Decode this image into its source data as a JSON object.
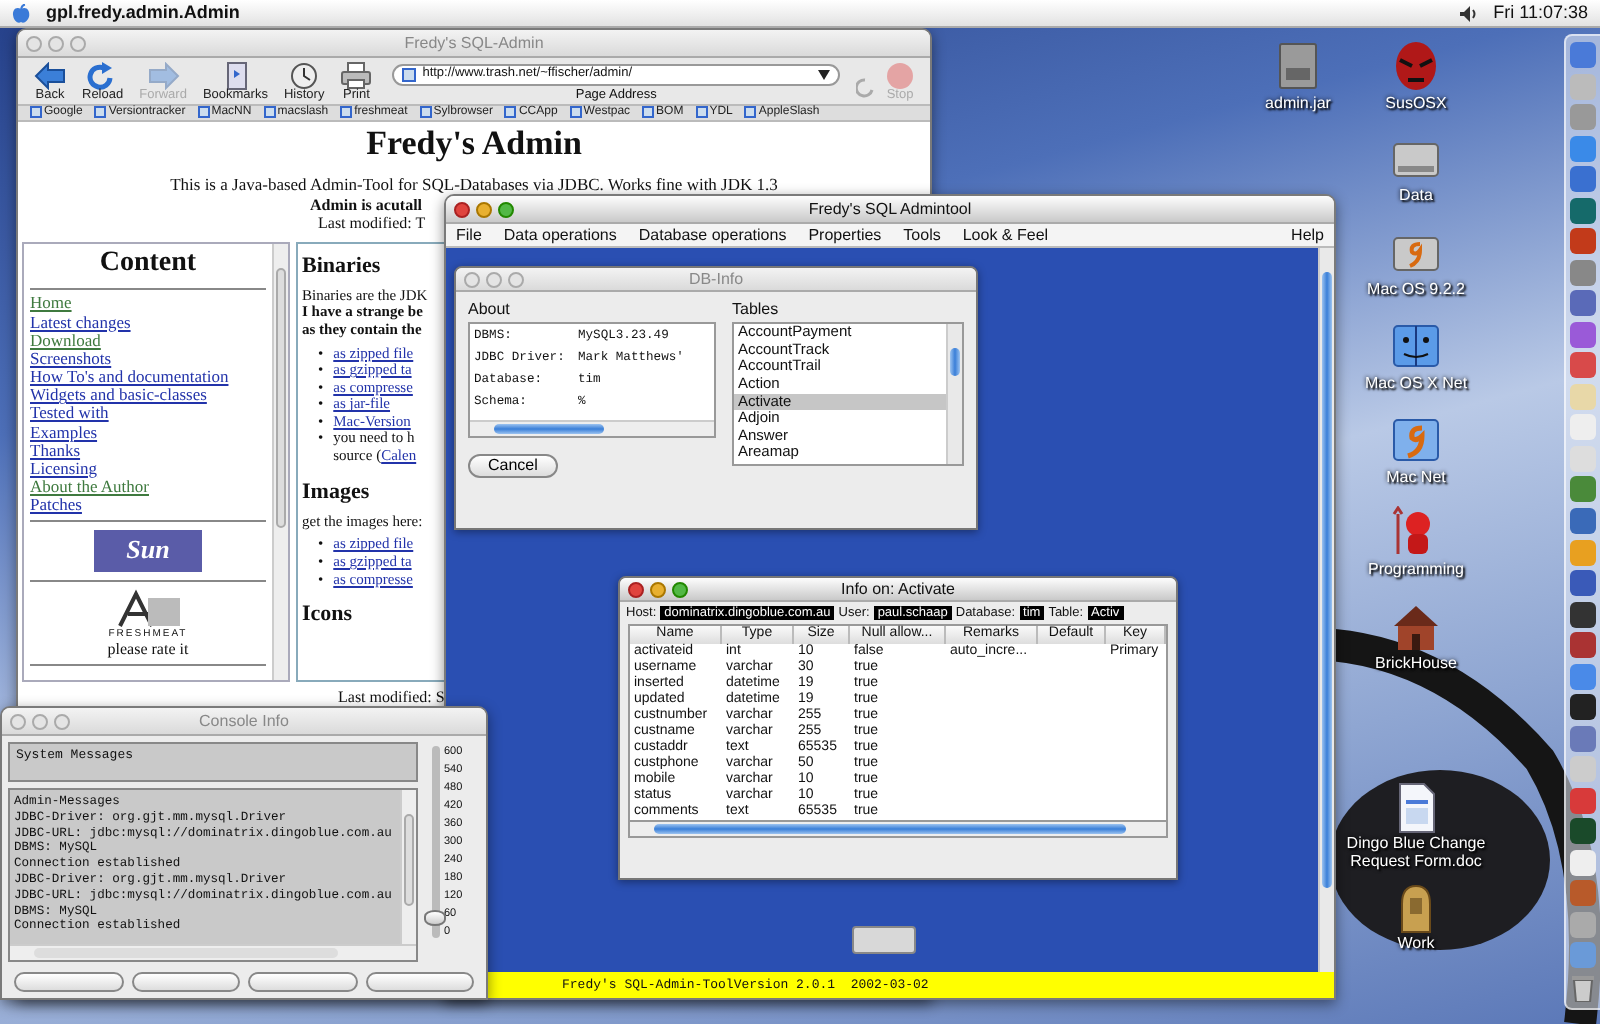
{
  "menu_bar": {
    "app_name": "gpl.fredy.admin.Admin",
    "clock": "Fri 11:07:38"
  },
  "browser": {
    "title": "Fredy's SQL-Admin",
    "active": false,
    "toolbar": [
      {
        "kind": "back",
        "label": "Back",
        "disabled": false
      },
      {
        "kind": "reload",
        "label": "Reload",
        "disabled": false
      },
      {
        "kind": "forward",
        "label": "Forward",
        "disabled": true
      },
      {
        "kind": "bookmarks",
        "label": "Bookmarks",
        "disabled": false
      },
      {
        "kind": "history",
        "label": "History",
        "disabled": false
      },
      {
        "kind": "print",
        "label": "Print",
        "disabled": false
      }
    ],
    "address": "http://www.trash.net/~ffischer/admin/",
    "address_label": "Page Address",
    "stop": {
      "label": "Stop",
      "disabled": true
    },
    "favorites": [
      "Google",
      "Versiontracker",
      "MacNN",
      "macslash",
      "freshmeat",
      "Sylbrowser",
      "CCApp",
      "Westpac",
      "BOM",
      "YDL",
      "AppleSlash"
    ],
    "page": {
      "heading": "Fredy's Admin",
      "intro": "This is a Java-based Admin-Tool for SQL-Databases via JDBC. Works fine with JDK 1.3",
      "notice": "Admin is acutall",
      "modified": "Last modified: T",
      "nav": {
        "title": "Content",
        "links": [
          {
            "label": "Home",
            "visited": true
          },
          {
            "label": "Latest changes",
            "visited": false
          },
          {
            "label": "Download",
            "visited": true
          },
          {
            "label": "Screenshots",
            "visited": false
          },
          {
            "label": "How To's and documentation",
            "visited": false
          },
          {
            "label": "Widgets and basic-classes",
            "visited": false
          },
          {
            "label": "Tested with",
            "visited": false
          },
          {
            "label": "Examples",
            "visited": false
          },
          {
            "label": "Thanks",
            "visited": false
          },
          {
            "label": "Licensing",
            "visited": false
          },
          {
            "label": "About the Author",
            "visited": true
          },
          {
            "label": "Patches",
            "visited": false
          }
        ],
        "sun_logo": "Sun",
        "freshmeat_logo": "FRESHMEAT",
        "rate": "please rate it"
      },
      "sections": [
        {
          "heading": "Binaries",
          "marker": "•",
          "lines": [
            {
              "text": "Binaries are the JDK",
              "bold": false
            },
            {
              "text": "I have a strange be",
              "bold": true
            },
            {
              "text": "as they contain the",
              "bold": true
            }
          ],
          "items": [
            {
              "kind": "link",
              "text": "as zipped file"
            },
            {
              "kind": "link",
              "text": "as gzipped ta"
            },
            {
              "kind": "link",
              "text": "as compresse"
            },
            {
              "kind": "link",
              "text": "as jar-file"
            },
            {
              "kind": "link",
              "text": "Mac-Version"
            },
            {
              "kind": "note",
              "text": "you need to h",
              "more": "source (",
              "link": "Calen"
            }
          ]
        },
        {
          "heading": "Images",
          "marker": "•",
          "lines": [
            {
              "text": "get the images here:",
              "bold": false
            }
          ],
          "items": [
            {
              "kind": "link",
              "text": "as zipped file"
            },
            {
              "kind": "link",
              "text": "as gzipped ta"
            },
            {
              "kind": "link",
              "text": "as compresse"
            }
          ]
        },
        {
          "heading": "Icons"
        }
      ],
      "footer": "Last modified: S"
    }
  },
  "sql_admin": {
    "title": "Fredy's SQL Admintool",
    "active": true,
    "menus": [
      "File",
      "Data operations",
      "Database operations",
      "Properties",
      "Tools",
      "Look & Feel"
    ],
    "help_menu": "Help",
    "status": "Fredy's SQL-Admin-ToolVersion 2.0.1  2002-03-02",
    "db_info": {
      "title": "DB-Info",
      "active": false,
      "about_label": "About",
      "about": [
        {
          "key": "DBMS:",
          "value": "MySQL3.23.49"
        },
        {
          "key": "JDBC Driver:",
          "value": "Mark Matthews'"
        },
        {
          "key": "Database:",
          "value": "tim"
        },
        {
          "key": "Schema:",
          "value": "%"
        }
      ],
      "cancel": "Cancel",
      "tables_label": "Tables",
      "tables": [
        {
          "name": "AccountPayment",
          "selected": false
        },
        {
          "name": "AccountTrack",
          "selected": false
        },
        {
          "name": "AccountTrail",
          "selected": false
        },
        {
          "name": "Action",
          "selected": false
        },
        {
          "name": "Activate",
          "selected": true
        },
        {
          "name": "Adjoin",
          "selected": false
        },
        {
          "name": "Answer",
          "selected": false
        },
        {
          "name": "Areamap",
          "selected": false
        }
      ]
    },
    "table_info": {
      "title": "Info on: Activate",
      "active": true,
      "host_label": "Host:",
      "host": "dominatrix.dingoblue.com.au",
      "user_label": "User:",
      "user": "paul.schaap",
      "database_label": "Database:",
      "database": "tim",
      "table_label": "Table:",
      "table": "Activ",
      "columns": [
        "Name",
        "Type",
        "Size",
        "Null allow...",
        "Remarks",
        "Default",
        "Key"
      ],
      "rows": [
        {
          "name": "activateid",
          "type": "int",
          "size": "10",
          "null_allowed": "false",
          "remarks": "auto_incre...",
          "key": "Primary"
        },
        {
          "name": "username",
          "type": "varchar",
          "size": "30",
          "null_allowed": "true"
        },
        {
          "name": "inserted",
          "type": "datetime",
          "size": "19",
          "null_allowed": "true"
        },
        {
          "name": "updated",
          "type": "datetime",
          "size": "19",
          "null_allowed": "true"
        },
        {
          "name": "custnumber",
          "type": "varchar",
          "size": "255",
          "null_allowed": "true"
        },
        {
          "name": "custname",
          "type": "varchar",
          "size": "255",
          "null_allowed": "true"
        },
        {
          "name": "custaddr",
          "type": "text",
          "size": "65535",
          "null_allowed": "true"
        },
        {
          "name": "custphone",
          "type": "varchar",
          "size": "50",
          "null_allowed": "true"
        },
        {
          "name": "mobile",
          "type": "varchar",
          "size": "10",
          "null_allowed": "true"
        },
        {
          "name": "status",
          "type": "varchar",
          "size": "10",
          "null_allowed": "true"
        },
        {
          "name": "comments",
          "type": "text",
          "size": "65535",
          "null_allowed": "true"
        }
      ]
    }
  },
  "console": {
    "title": "Console Info",
    "active": false,
    "system_messages": "System Messages",
    "messages": [
      "Admin-Messages",
      "JDBC-Driver: org.gjt.mm.mysql.Driver",
      "JDBC-URL: jdbc:mysql://dominatrix.dingoblue.com.au",
      "DBMS: MySQL",
      "Connection established",
      "JDBC-Driver: org.gjt.mm.mysql.Driver",
      "JDBC-URL: jdbc:mysql://dominatrix.dingoblue.com.au",
      "DBMS: MySQL",
      "Connection established"
    ],
    "slider": {
      "ticks": [
        "600",
        "540",
        "480",
        "420",
        "360",
        "300",
        "240",
        "180",
        "120",
        "60",
        "0"
      ],
      "level": 0.1
    }
  },
  "desktop_icons": [
    {
      "kind": "jar",
      "label": "admin.jar"
    },
    {
      "kind": "mask",
      "label": "SusOSX"
    },
    {
      "kind": "drive",
      "label": "Data"
    },
    {
      "kind": "drive9",
      "label": "Mac OS 9.2.2"
    },
    {
      "kind": "finder",
      "label": "Mac OS X Net"
    },
    {
      "kind": "net9",
      "label": "Mac Net"
    },
    {
      "kind": "devil",
      "label": "Programming"
    },
    {
      "kind": "house",
      "label": "BrickHouse"
    },
    {
      "kind": "document",
      "label": "Dingo Blue Change Request Form.doc"
    },
    {
      "kind": "statue",
      "label": "Work"
    }
  ]
}
